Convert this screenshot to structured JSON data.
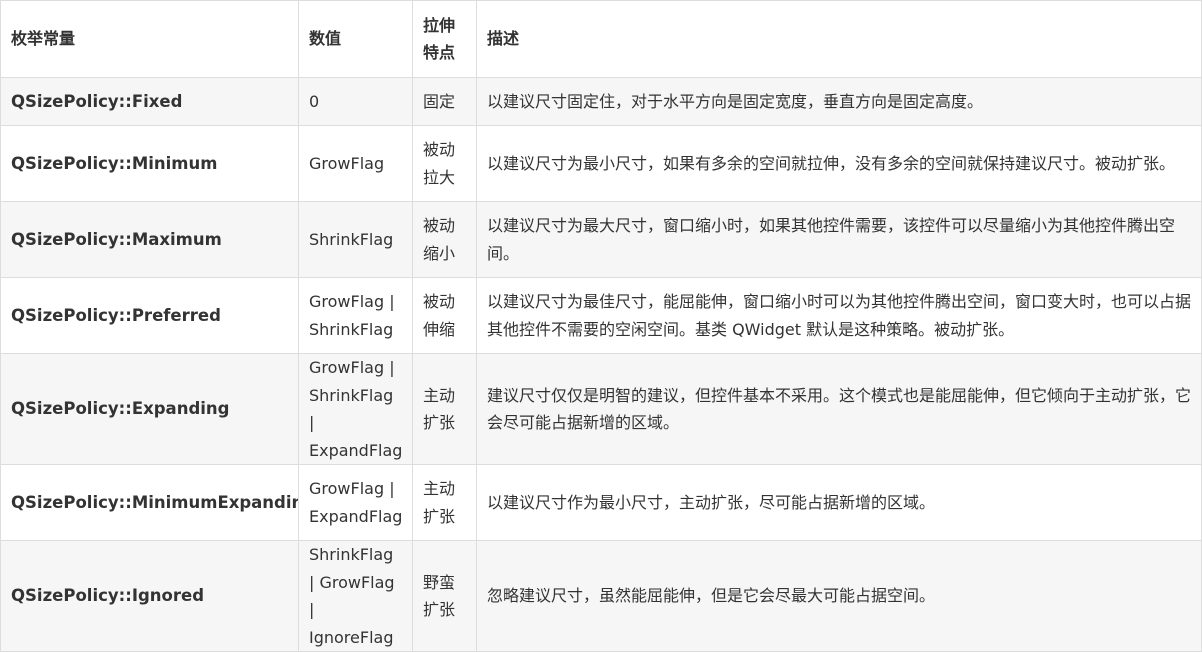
{
  "table": {
    "headers": [
      "枚举常量",
      "数值",
      "拉伸特点",
      "描述"
    ],
    "rows": [
      {
        "enum": "QSizePolicy::Fixed",
        "value": "0",
        "feature": "固定",
        "desc": "以建议尺寸固定住，对于水平方向是固定宽度，垂直方向是固定高度。"
      },
      {
        "enum": "QSizePolicy::Minimum",
        "value": "GrowFlag",
        "feature": "被动拉大",
        "desc": "以建议尺寸为最小尺寸，如果有多余的空间就拉伸，没有多余的空间就保持建议尺寸。被动扩张。"
      },
      {
        "enum": "QSizePolicy::Maximum",
        "value": "ShrinkFlag",
        "feature": "被动缩小",
        "desc": "以建议尺寸为最大尺寸，窗口缩小时，如果其他控件需要，该控件可以尽量缩小为其他控件腾出空间。"
      },
      {
        "enum": "QSizePolicy::Preferred",
        "value": "GrowFlag | ShrinkFlag",
        "feature": "被动伸缩",
        "desc": "以建议尺寸为最佳尺寸，能屈能伸，窗口缩小时可以为其他控件腾出空间，窗口变大时，也可以占据其他控件不需要的空闲空间。基类 QWidget 默认是这种策略。被动扩张。"
      },
      {
        "enum": "QSizePolicy::Expanding",
        "value": "GrowFlag | ShrinkFlag | ExpandFlag",
        "feature": "主动扩张",
        "desc": "建议尺寸仅仅是明智的建议，但控件基本不采用。这个模式也是能屈能伸，但它倾向于主动扩张，它会尽可能占据新增的区域。"
      },
      {
        "enum": "QSizePolicy::MinimumExpanding",
        "value": "GrowFlag | ExpandFlag",
        "feature": "主动扩张",
        "desc": "以建议尺寸作为最小尺寸，主动扩张，尽可能占据新增的区域。"
      },
      {
        "enum": "QSizePolicy::Ignored",
        "value": "ShrinkFlag | GrowFlag | IgnoreFlag",
        "feature": "野蛮扩张",
        "desc": "忽略建议尺寸，虽然能屈能伸，但是它会尽最大可能占据空间。"
      }
    ]
  }
}
